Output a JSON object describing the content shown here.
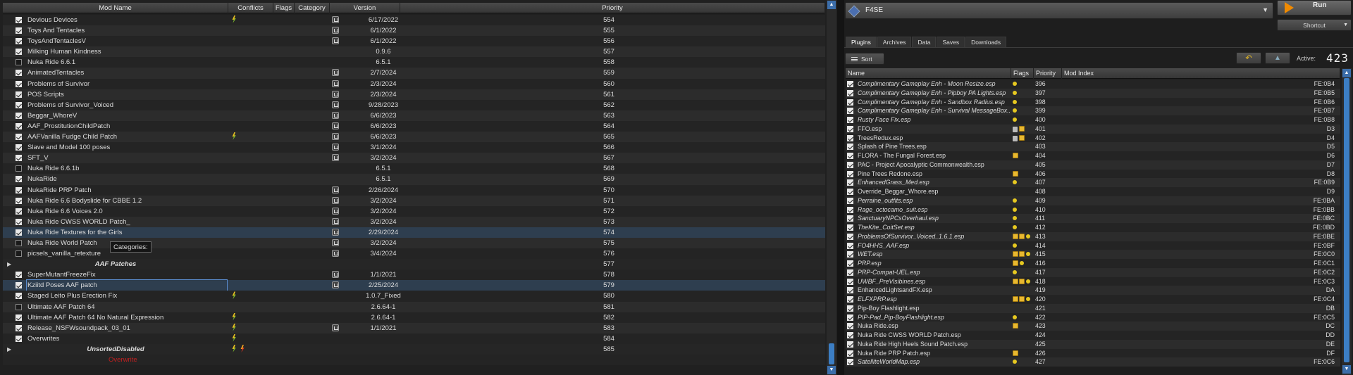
{
  "left": {
    "headers": {
      "name": "Mod Name",
      "conflicts": "Conflicts",
      "flags": "Flags",
      "category": "Category",
      "version": "Version",
      "priority": "Priority"
    },
    "tooltip": "Categories:",
    "rows": [
      {
        "type": "mod",
        "checked": true,
        "name": "Devious Devices",
        "conflict": "bolt",
        "cat": true,
        "version": "6/17/2022",
        "priority": "554"
      },
      {
        "type": "mod",
        "checked": true,
        "name": "Toys And Tentacles",
        "conflict": "",
        "cat": true,
        "version": "6/1/2022",
        "priority": "555"
      },
      {
        "type": "mod",
        "checked": true,
        "name": "ToysAndTentaclesV",
        "conflict": "",
        "cat": true,
        "version": "6/1/2022",
        "priority": "556"
      },
      {
        "type": "mod",
        "checked": true,
        "name": "Milking Human Kindness",
        "conflict": "",
        "cat": false,
        "version": "0.9.6",
        "priority": "557"
      },
      {
        "type": "mod",
        "checked": false,
        "name": "Nuka Ride 6.6.1",
        "conflict": "",
        "cat": false,
        "version": "6.5.1",
        "priority": "558"
      },
      {
        "type": "mod",
        "checked": true,
        "name": "AnimatedTentacles",
        "conflict": "",
        "cat": true,
        "version": "2/7/2024",
        "priority": "559"
      },
      {
        "type": "mod",
        "checked": true,
        "name": "Problems of Survivor",
        "conflict": "",
        "cat": true,
        "version": "2/3/2024",
        "priority": "560"
      },
      {
        "type": "mod",
        "checked": true,
        "name": "POS Scripts",
        "conflict": "",
        "cat": true,
        "version": "2/3/2024",
        "priority": "561"
      },
      {
        "type": "mod",
        "checked": true,
        "name": "Problems of Survivor_Voiced",
        "conflict": "",
        "cat": true,
        "version": "9/28/2023",
        "priority": "562"
      },
      {
        "type": "mod",
        "checked": true,
        "name": "Beggar_WhoreV",
        "conflict": "",
        "cat": true,
        "version": "6/6/2023",
        "priority": "563"
      },
      {
        "type": "mod",
        "checked": true,
        "name": "AAF_ProstitutionChildPatch",
        "conflict": "",
        "cat": true,
        "version": "6/6/2023",
        "priority": "564"
      },
      {
        "type": "mod",
        "checked": true,
        "name": "AAFVanilla Fudge Child Patch",
        "conflict": "bolt",
        "cat": true,
        "version": "6/6/2023",
        "priority": "565"
      },
      {
        "type": "mod",
        "checked": true,
        "name": "Slave and Model 100 poses",
        "conflict": "",
        "cat": true,
        "version": "3/1/2024",
        "priority": "566"
      },
      {
        "type": "mod",
        "checked": true,
        "name": "SFT_V",
        "conflict": "",
        "cat": true,
        "version": "3/2/2024",
        "priority": "567"
      },
      {
        "type": "mod",
        "checked": false,
        "name": "Nuka Ride 6.6.1b",
        "conflict": "",
        "cat": false,
        "version": "6.5.1",
        "priority": "568"
      },
      {
        "type": "mod",
        "checked": true,
        "name": "NukaRide",
        "conflict": "",
        "cat": false,
        "version": "6.5.1",
        "priority": "569"
      },
      {
        "type": "mod",
        "checked": true,
        "name": "NukaRide PRP Patch",
        "conflict": "",
        "cat": true,
        "version": "2/26/2024",
        "priority": "570"
      },
      {
        "type": "mod",
        "checked": true,
        "name": "Nuka Ride 6.6 Bodyslide for CBBE 1.2",
        "conflict": "",
        "cat": true,
        "version": "3/2/2024",
        "priority": "571"
      },
      {
        "type": "mod",
        "checked": true,
        "name": "Nuka Ride 6.6 Voices 2.0",
        "conflict": "",
        "cat": true,
        "version": "3/2/2024",
        "priority": "572"
      },
      {
        "type": "mod",
        "checked": true,
        "name": "Nuka Ride CWSS WORLD Patch_",
        "conflict": "",
        "cat": true,
        "version": "3/2/2024",
        "priority": "573"
      },
      {
        "type": "mod",
        "checked": true,
        "name": "Nuka Ride Textures for the Girls",
        "conflict": "",
        "cat": true,
        "version": "2/29/2024",
        "priority": "574",
        "hl": true
      },
      {
        "type": "mod",
        "checked": false,
        "name": "Nuka Ride World Patch",
        "conflict": "",
        "cat": true,
        "version": "3/2/2024",
        "priority": "575"
      },
      {
        "type": "mod",
        "checked": false,
        "name": "picsels_vanilla_retexture",
        "conflict": "",
        "cat": true,
        "version": "3/4/2024",
        "priority": "576"
      },
      {
        "type": "sep",
        "name": "AAF Patches",
        "priority": "577"
      },
      {
        "type": "mod",
        "checked": true,
        "name": "SuperMutantFreezeFix",
        "conflict": "",
        "cat": true,
        "version": "1/1/2021",
        "priority": "578"
      },
      {
        "type": "mod",
        "checked": true,
        "name": "Kziitd Poses AAF patch",
        "conflict": "",
        "cat": true,
        "version": "2/25/2024",
        "priority": "579",
        "hl": true,
        "boxed": true
      },
      {
        "type": "mod",
        "checked": true,
        "name": "Staged Leito Plus Erection Fix",
        "conflict": "bolt",
        "cat": false,
        "version": "1.0.7_Fixed",
        "priority": "580"
      },
      {
        "type": "mod",
        "checked": false,
        "name": "Ultimate AAF Patch 64",
        "conflict": "",
        "cat": false,
        "version": "2.6.64-1",
        "priority": "581"
      },
      {
        "type": "mod",
        "checked": true,
        "name": "Ultimate AAF Patch 64 No Natural Expression",
        "conflict": "bolt",
        "cat": false,
        "version": "2.6.64-1",
        "priority": "582"
      },
      {
        "type": "mod",
        "checked": true,
        "name": "Release_NSFWsoundpack_03_01",
        "conflict": "bolt",
        "cat": true,
        "version": "1/1/2021",
        "priority": "583"
      },
      {
        "type": "mod",
        "checked": true,
        "name": "Overwrites",
        "conflict": "bolt",
        "cat": false,
        "version": "",
        "priority": "584"
      },
      {
        "type": "sep",
        "name": "UnsortedDisabled",
        "priority": "585",
        "conflict": "bolt2"
      },
      {
        "type": "overwrite",
        "name": "Overwrite"
      }
    ]
  },
  "right": {
    "executable": "F4SE",
    "run_label": "Run",
    "shortcut_label": "Shortcut",
    "tabs": [
      "Plugins",
      "Archives",
      "Data",
      "Saves",
      "Downloads"
    ],
    "sort_label": "Sort",
    "active_label": "Active:",
    "active_count": "423",
    "headers": {
      "name": "Name",
      "flags": "Flags",
      "priority": "Priority",
      "mod_index": "Mod Index"
    },
    "plugins": [
      {
        "name": "Complimentary Gameplay Enh - Moon Resize.esp",
        "it": true,
        "flags": "dot",
        "priority": "396",
        "index": "FE:0B4"
      },
      {
        "name": "Complimentary Gameplay Enh - Pipboy PA Lights.esp",
        "it": true,
        "flags": "dot",
        "priority": "397",
        "index": "FE:0B5"
      },
      {
        "name": "Complimentary Gameplay Enh - Sandbox Radius.esp",
        "it": true,
        "flags": "dot",
        "priority": "398",
        "index": "FE:0B6"
      },
      {
        "name": "Complimentary Gameplay Enh - Survival MessageBox...",
        "it": true,
        "flags": "dot",
        "priority": "399",
        "index": "FE:0B7"
      },
      {
        "name": "Rusty Face Fix.esp",
        "it": true,
        "flags": "dot",
        "priority": "400",
        "index": "FE:0B8"
      },
      {
        "name": "FFO.esp",
        "it": false,
        "flags": "lockcube",
        "priority": "401",
        "index": "D3"
      },
      {
        "name": "TreesRedux.esp",
        "it": false,
        "flags": "lockcube",
        "priority": "402",
        "index": "D4"
      },
      {
        "name": "Splash of Pine Trees.esp",
        "it": false,
        "flags": "",
        "priority": "403",
        "index": "D5"
      },
      {
        "name": "FLORA - The Fungal Forest.esp",
        "it": false,
        "flags": "cube",
        "priority": "404",
        "index": "D6"
      },
      {
        "name": "PAC - Project Apocalyptic Commonwealth.esp",
        "it": false,
        "flags": "",
        "priority": "405",
        "index": "D7"
      },
      {
        "name": "Pine Trees Redone.esp",
        "it": false,
        "flags": "cube",
        "priority": "406",
        "index": "D8"
      },
      {
        "name": "EnhancedGrass_Med.esp",
        "it": true,
        "flags": "dot",
        "priority": "407",
        "index": "FE:0B9"
      },
      {
        "name": "Override_Beggar_Whore.esp",
        "it": false,
        "flags": "",
        "priority": "408",
        "index": "D9"
      },
      {
        "name": "Perraine_outfits.esp",
        "it": true,
        "flags": "dot",
        "priority": "409",
        "index": "FE:0BA"
      },
      {
        "name": "Rage_octocamo_suit.esp",
        "it": true,
        "flags": "dot",
        "priority": "410",
        "index": "FE:0BB"
      },
      {
        "name": "SanctuaryNPCsOverhaul.esp",
        "it": true,
        "flags": "dot",
        "priority": "411",
        "index": "FE:0BC"
      },
      {
        "name": "TheKite_CoitSet.esp",
        "it": true,
        "flags": "dot",
        "priority": "412",
        "index": "FE:0BD"
      },
      {
        "name": "ProblemsOfSurvivor_Voiced_1.6.1.esp",
        "it": true,
        "flags": "cubecubedot",
        "priority": "413",
        "index": "FE:0BE"
      },
      {
        "name": "FO4HHS_AAF.esp",
        "it": true,
        "flags": "dot",
        "priority": "414",
        "index": "FE:0BF"
      },
      {
        "name": "WET.esp",
        "it": true,
        "flags": "cubecubedot",
        "priority": "415",
        "index": "FE:0C0"
      },
      {
        "name": "PRP.esp",
        "it": true,
        "flags": "cubedot",
        "priority": "416",
        "index": "FE:0C1"
      },
      {
        "name": "PRP-Compat-UEL.esp",
        "it": true,
        "flags": "dot",
        "priority": "417",
        "index": "FE:0C2"
      },
      {
        "name": "UWBF_PreVisibines.esp",
        "it": true,
        "flags": "cubecubedot",
        "priority": "418",
        "index": "FE:0C3"
      },
      {
        "name": "EnhancedLightsandFX.esp",
        "it": false,
        "flags": "",
        "priority": "419",
        "index": "DA"
      },
      {
        "name": "ELFXPRP.esp",
        "it": true,
        "flags": "cubecubedot",
        "priority": "420",
        "index": "FE:0C4"
      },
      {
        "name": "Pip-Boy Flashlight.esp",
        "it": false,
        "flags": "",
        "priority": "421",
        "index": "DB"
      },
      {
        "name": "PIP-Pad_Pip-BoyFlashlight.esp",
        "it": true,
        "flags": "dot",
        "priority": "422",
        "index": "FE:0C5"
      },
      {
        "name": "Nuka Ride.esp",
        "it": false,
        "flags": "cube",
        "priority": "423",
        "index": "DC"
      },
      {
        "name": "Nuka Ride CWSS WORLD Patch.esp",
        "it": false,
        "flags": "",
        "priority": "424",
        "index": "DD"
      },
      {
        "name": "Nuka Ride High Heels Sound Patch.esp",
        "it": false,
        "flags": "",
        "priority": "425",
        "index": "DE"
      },
      {
        "name": "Nuka Ride PRP Patch.esp",
        "it": false,
        "flags": "cube",
        "priority": "426",
        "index": "DF"
      },
      {
        "name": "SatelliteWorldMap.esp",
        "it": true,
        "flags": "dot",
        "priority": "427",
        "index": "FE:0C6"
      }
    ]
  }
}
